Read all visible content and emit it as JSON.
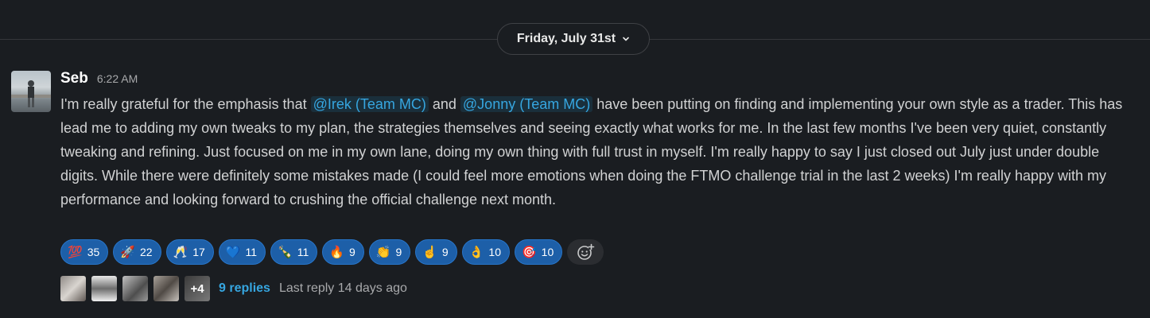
{
  "divider": {
    "date_label": "Friday, July 31st"
  },
  "message": {
    "author": "Seb",
    "time": "6:22 AM",
    "text_before_mention1": "I'm really grateful for the emphasis that ",
    "mention1": "@Irek (Team MC)",
    "text_between": " and ",
    "mention2": "@Jonny (Team MC)",
    "text_after": " have been putting on finding and implementing your own style as a trader. This has lead me to adding my own tweaks to my plan, the strategies themselves and seeing exactly what works for me. In the last few months I've been very quiet, constantly tweaking and refining. Just focused on me in my own lane, doing my own thing with full trust in myself. I'm really happy to say I just closed out July just under double digits. While there were definitely some mistakes made (I could feel more emotions when doing the FTMO challenge trial in the last 2 weeks) I'm really happy with my performance and looking forward to crushing the official challenge next month."
  },
  "reactions": [
    {
      "emoji": "💯",
      "count": "35"
    },
    {
      "emoji": "🚀",
      "count": "22"
    },
    {
      "emoji": "🥂",
      "count": "17"
    },
    {
      "emoji": "💙",
      "count": "11"
    },
    {
      "emoji": "🍾",
      "count": "11"
    },
    {
      "emoji": "🔥",
      "count": "9"
    },
    {
      "emoji": "👏",
      "count": "9"
    },
    {
      "emoji": "☝️",
      "count": "9"
    },
    {
      "emoji": "👌",
      "count": "10"
    },
    {
      "emoji": "🎯",
      "count": "10"
    }
  ],
  "thread": {
    "more_avatars": "+4",
    "replies_label": "9 replies",
    "last_reply": "Last reply 14 days ago"
  }
}
